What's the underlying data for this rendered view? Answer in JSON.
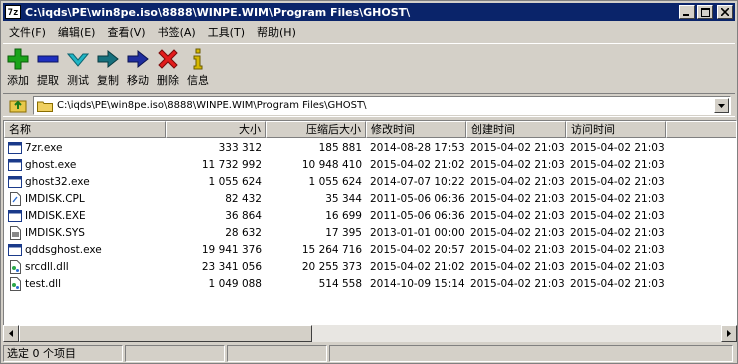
{
  "window": {
    "title": "C:\\iqds\\PE\\win8pe.iso\\8888\\WINPE.WIM\\Program Files\\GHOST\\",
    "app_icon_text": "7z"
  },
  "menu": [
    {
      "label": "文件(F)"
    },
    {
      "label": "编辑(E)"
    },
    {
      "label": "查看(V)"
    },
    {
      "label": "书签(A)"
    },
    {
      "label": "工具(T)"
    },
    {
      "label": "帮助(H)"
    }
  ],
  "toolbar": [
    {
      "label": "添加",
      "icon": "plus-icon",
      "color": "#1aa31a"
    },
    {
      "label": "提取",
      "icon": "minus-icon",
      "color": "#1e2fbf"
    },
    {
      "label": "测试",
      "icon": "checkmark-icon",
      "color": "#1fb6c6"
    },
    {
      "label": "复制",
      "icon": "copy-arrow-icon",
      "color": "#16707d"
    },
    {
      "label": "移动",
      "icon": "move-arrow-icon",
      "color": "#1f2d9e"
    },
    {
      "label": "删除",
      "icon": "delete-x-icon",
      "color": "#e31c1c"
    },
    {
      "label": "信息",
      "icon": "info-icon",
      "color": "#d6b800"
    }
  ],
  "address": {
    "path": "C:\\iqds\\PE\\win8pe.iso\\8888\\WINPE.WIM\\Program Files\\GHOST\\"
  },
  "columns": [
    {
      "label": "名称",
      "align": "left"
    },
    {
      "label": "大小",
      "align": "right"
    },
    {
      "label": "压缩后大小",
      "align": "right"
    },
    {
      "label": "修改时间",
      "align": "left"
    },
    {
      "label": "创建时间",
      "align": "left"
    },
    {
      "label": "访问时间",
      "align": "left"
    }
  ],
  "files": [
    {
      "name": "7zr.exe",
      "icon": "exe-window-icon",
      "size": "333 312",
      "packed": "185 881",
      "modified": "2014-08-28 17:53",
      "created": "2015-04-02 21:03",
      "accessed": "2015-04-02 21:03"
    },
    {
      "name": "ghost.exe",
      "icon": "exe-window-icon",
      "size": "11 732 992",
      "packed": "10 948 410",
      "modified": "2015-04-02 21:02",
      "created": "2015-04-02 21:03",
      "accessed": "2015-04-02 21:03"
    },
    {
      "name": "ghost32.exe",
      "icon": "exe-window-icon",
      "size": "1 055 624",
      "packed": "1 055 624",
      "modified": "2014-07-07 10:22",
      "created": "2015-04-02 21:03",
      "accessed": "2015-04-02 21:03"
    },
    {
      "name": "IMDISK.CPL",
      "icon": "cpl-file-icon",
      "size": "82 432",
      "packed": "35 344",
      "modified": "2011-05-06 06:36",
      "created": "2015-04-02 21:03",
      "accessed": "2015-04-02 21:03"
    },
    {
      "name": "IMDISK.EXE",
      "icon": "exe-window-icon",
      "size": "36 864",
      "packed": "16 699",
      "modified": "2011-05-06 06:36",
      "created": "2015-04-02 21:03",
      "accessed": "2015-04-02 21:03"
    },
    {
      "name": "IMDISK.SYS",
      "icon": "sys-file-icon",
      "size": "28 632",
      "packed": "17 395",
      "modified": "2013-01-01 00:00",
      "created": "2015-04-02 21:03",
      "accessed": "2015-04-02 21:03"
    },
    {
      "name": "qddsghost.exe",
      "icon": "exe-window-icon",
      "size": "19 941 376",
      "packed": "15 264 716",
      "modified": "2015-04-02 20:57",
      "created": "2015-04-02 21:03",
      "accessed": "2015-04-02 21:03"
    },
    {
      "name": "srcdll.dll",
      "icon": "dll-file-icon",
      "size": "23 341 056",
      "packed": "20 255 373",
      "modified": "2015-04-02 21:02",
      "created": "2015-04-02 21:03",
      "accessed": "2015-04-02 21:03"
    },
    {
      "name": "test.dll",
      "icon": "dll-file-icon",
      "size": "1 049 088",
      "packed": "514 558",
      "modified": "2014-10-09 15:14",
      "created": "2015-04-02 21:03",
      "accessed": "2015-04-02 21:03"
    }
  ],
  "status": {
    "selection": "选定 0 个项目"
  },
  "colors": {
    "titlebar": "#0a246a",
    "chrome": "#d4d0c8"
  }
}
